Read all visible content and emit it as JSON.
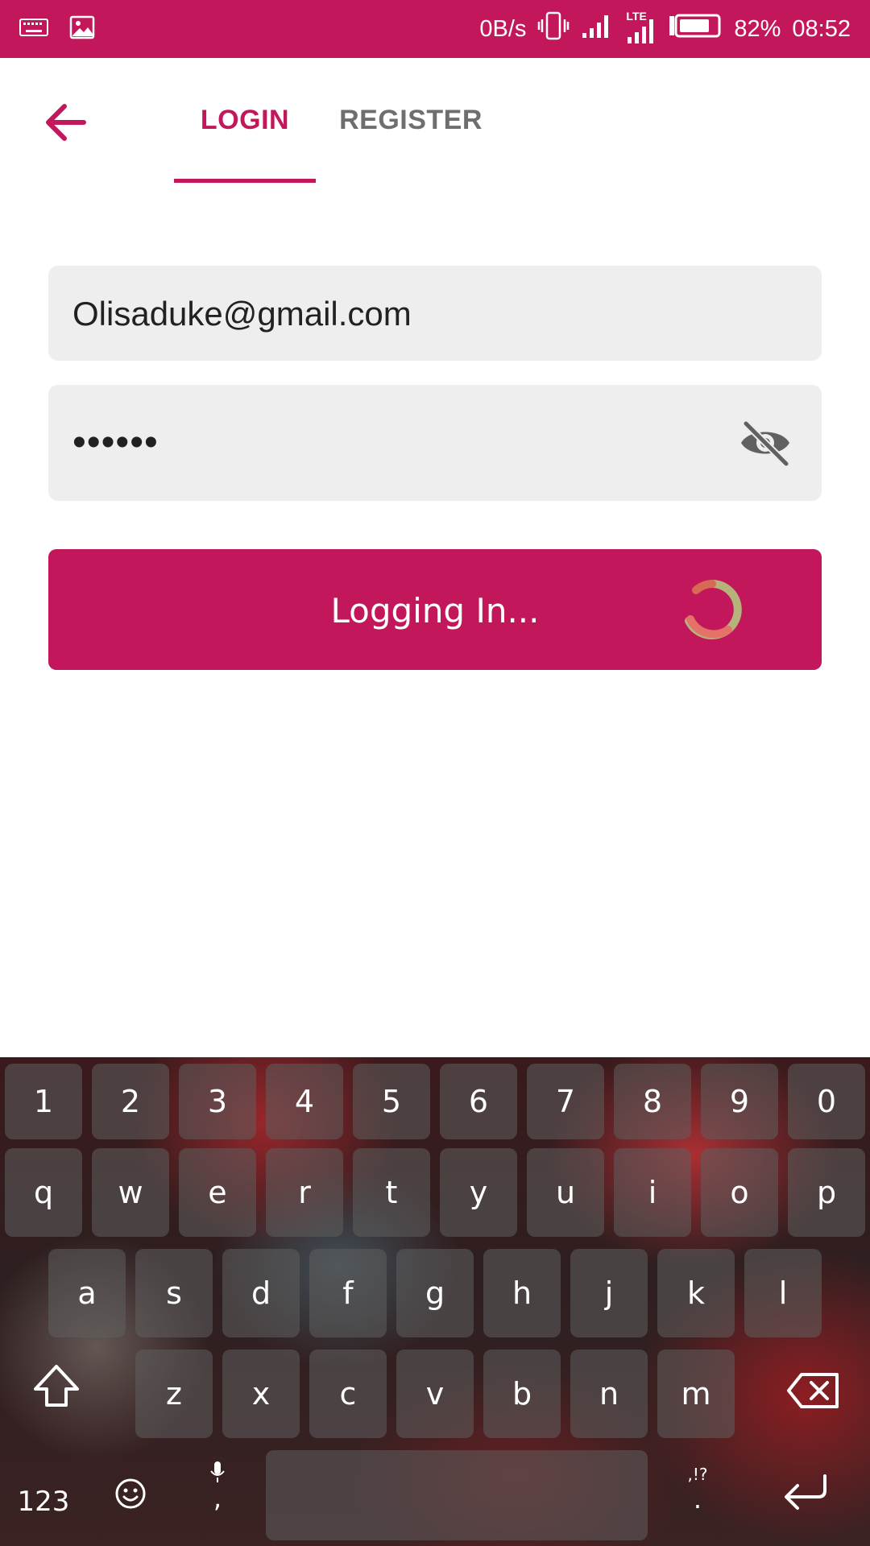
{
  "status_bar": {
    "net_speed": "0B/s",
    "lte": "LTE",
    "battery_pct": "82%",
    "time": "08:52",
    "icons": [
      "keyboard-icon",
      "image-icon",
      "vibrate-icon",
      "signal-icon",
      "lte-signal-icon",
      "battery-icon"
    ],
    "battery_level": 0.82
  },
  "header": {
    "back_icon": "arrow-back-icon",
    "tabs": [
      {
        "label": "LOGIN",
        "active": true
      },
      {
        "label": "REGISTER",
        "active": false
      }
    ]
  },
  "form": {
    "email_value": "Olisaduke@gmail.com",
    "password_value": "••••••",
    "visibility_icon": "eye-off-icon",
    "submit_label": "Logging In...",
    "spinner_icon": "loading-spinner-icon"
  },
  "keyboard": {
    "number_row": [
      "1",
      "2",
      "3",
      "4",
      "5",
      "6",
      "7",
      "8",
      "9",
      "0"
    ],
    "row1": [
      "q",
      "w",
      "e",
      "r",
      "t",
      "y",
      "u",
      "i",
      "o",
      "p"
    ],
    "row2": [
      "a",
      "s",
      "d",
      "f",
      "g",
      "h",
      "j",
      "k",
      "l"
    ],
    "row3": [
      "z",
      "x",
      "c",
      "v",
      "b",
      "n",
      "m"
    ],
    "symbols_label": "123",
    "comma": ",",
    "period": ".",
    "punct_label": ",!?",
    "shift_icon": "shift-icon",
    "backspace_icon": "backspace-icon",
    "emoji_icon": "emoji-icon",
    "mic_icon": "mic-icon",
    "enter_icon": "enter-icon"
  },
  "colors": {
    "accent": "#c2185b",
    "tab_inactive": "#6e6e6e",
    "field_bg": "#eeeeee"
  }
}
